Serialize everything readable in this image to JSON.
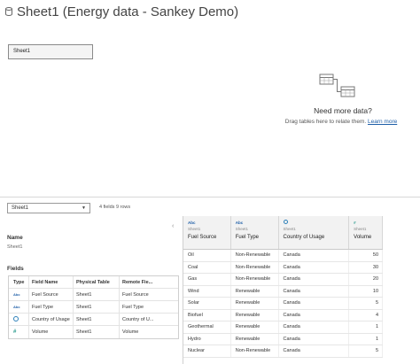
{
  "header": {
    "title": "Sheet1 (Energy data - Sankey Demo)",
    "icon": "database-icon"
  },
  "canvas": {
    "table_chip": "Sheet1",
    "prompt_title": "Need more data?",
    "prompt_text": "Drag tables here to relate them.",
    "learn_more": "Learn more"
  },
  "metadata": {
    "selected_sheet": "Sheet1",
    "field_count": "4 fields 9 rows",
    "name_label": "Name",
    "name_value": "Sheet1",
    "fields_label": "Fields",
    "columns": [
      "Type",
      "Field Name",
      "Physical Table",
      "Remote Fie..."
    ],
    "fields": [
      {
        "type": "Abc",
        "name": "Fuel Source",
        "physical": "Sheet1",
        "remote": "Fuel Source"
      },
      {
        "type": "Abc",
        "name": "Fuel Type",
        "physical": "Sheet1",
        "remote": "Fuel Type"
      },
      {
        "type": "geo",
        "name": "Country of Usage",
        "physical": "Sheet1",
        "remote": "Country of U..."
      },
      {
        "type": "#",
        "name": "Volume",
        "physical": "Sheet1",
        "remote": "Volume"
      }
    ]
  },
  "grid": {
    "columns": [
      {
        "type": "Abc",
        "source": "Sheet1",
        "name": "Fuel Source"
      },
      {
        "type": "Abc",
        "source": "Sheet1",
        "name": "Fuel Type"
      },
      {
        "type": "geo",
        "source": "Sheet1",
        "name": "Country of Usage"
      },
      {
        "type": "#",
        "source": "Sheet1",
        "name": "Volume"
      }
    ],
    "rows": [
      [
        "Oil",
        "Non-Renewable",
        "Canada",
        "50"
      ],
      [
        "Coal",
        "Non-Renewable",
        "Canada",
        "30"
      ],
      [
        "Gas",
        "Non-Renewable",
        "Canada",
        "20"
      ],
      [
        "Wind",
        "Renewable",
        "Canada",
        "10"
      ],
      [
        "Solar",
        "Renewable",
        "Canada",
        "5"
      ],
      [
        "Biofuel",
        "Renewable",
        "Canada",
        "4"
      ],
      [
        "Geothermal",
        "Renewable",
        "Canada",
        "1"
      ],
      [
        "Hydro",
        "Renewable",
        "Canada",
        "1"
      ],
      [
        "Nuclear",
        "Non-Renewable",
        "Canada",
        "5"
      ]
    ]
  },
  "colors": {
    "link": "#1f5fa8",
    "string_type": "#1f5fa8",
    "geo_type": "#2b7fb8",
    "number_type": "#2b9b8e"
  }
}
